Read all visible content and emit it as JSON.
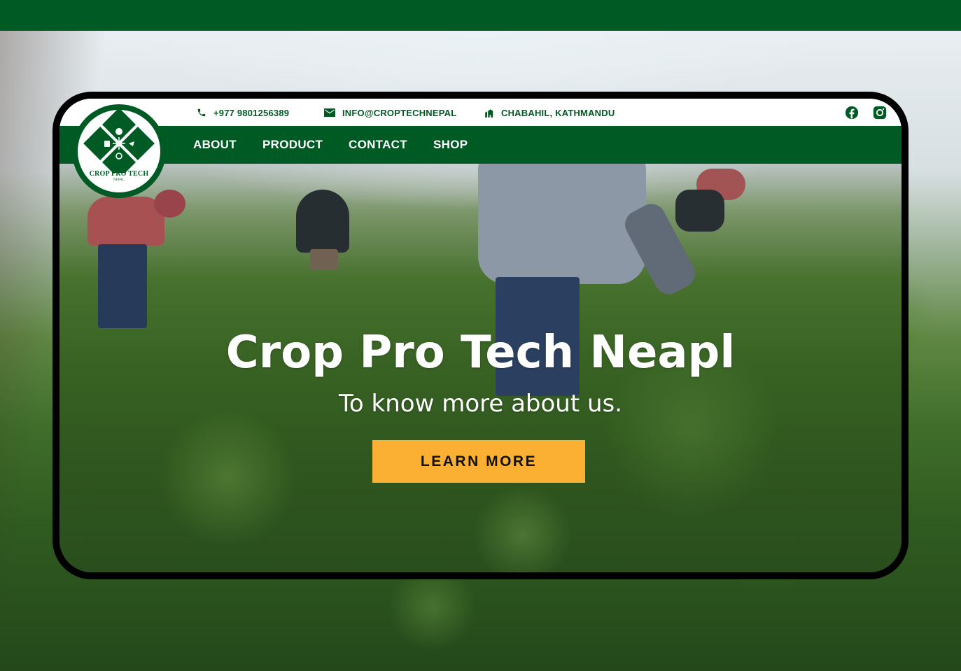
{
  "colors": {
    "brand_green": "#005a24",
    "cta_yellow": "#fbb033",
    "white": "#ffffff"
  },
  "contact_bar": {
    "phone": {
      "icon": "phone-icon",
      "text": "+977 9801256389"
    },
    "email": {
      "icon": "mail-icon",
      "text": "INFO@CROPTECHNEPAL"
    },
    "address": {
      "icon": "location-icon",
      "text": "CHABAHIL, KATHMANDU"
    },
    "social": [
      "facebook-icon",
      "instagram-icon"
    ]
  },
  "logo": {
    "name": "CROP PRO TECH",
    "sub": "NEPAL"
  },
  "nav": {
    "items": [
      {
        "label": "ABOUT"
      },
      {
        "label": "PRODUCT"
      },
      {
        "label": "CONTACT"
      },
      {
        "label": "SHOP"
      }
    ]
  },
  "hero": {
    "title": "Crop Pro Tech Neapl",
    "subtitle": "To know more about us.",
    "cta_label": "LEARN MORE"
  }
}
